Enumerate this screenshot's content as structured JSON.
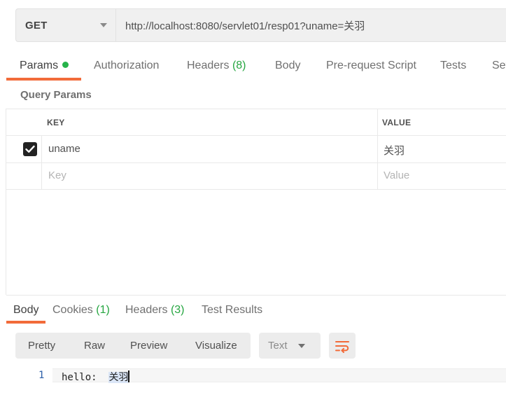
{
  "request": {
    "method": "GET",
    "url": "http://localhost:8080/servlet01/resp01?uname=关羽"
  },
  "request_tabs": [
    {
      "label": "Params",
      "count": ""
    },
    {
      "label": "Authorization",
      "count": ""
    },
    {
      "label": "Headers",
      "count": "(8)"
    },
    {
      "label": "Body",
      "count": ""
    },
    {
      "label": "Pre-request Script",
      "count": ""
    },
    {
      "label": "Tests",
      "count": ""
    },
    {
      "label": "Set",
      "count": ""
    }
  ],
  "query_params": {
    "title": "Query Params",
    "key_header": "KEY",
    "value_header": "VALUE",
    "rows": [
      {
        "key": "uname",
        "value": "关羽",
        "checked": true
      }
    ],
    "placeholder_key": "Key",
    "placeholder_value": "Value"
  },
  "response_tabs": [
    {
      "label": "Body",
      "count": ""
    },
    {
      "label": "Cookies",
      "count": "(1)"
    },
    {
      "label": "Headers",
      "count": "(3)"
    },
    {
      "label": "Test Results",
      "count": ""
    }
  ],
  "view_modes": [
    "Pretty",
    "Raw",
    "Preview",
    "Visualize"
  ],
  "format_select": "Text",
  "response_body": {
    "line_number": "1",
    "prefix": "hello:  ",
    "highlighted": "关羽"
  },
  "colors": {
    "accent": "#f26b3a",
    "count_green": "#26a641",
    "active_dot": "#26b34a"
  },
  "icons": {
    "method_dropdown": "chevron-down-icon",
    "format_dropdown": "chevron-down-icon",
    "checkbox": "checkmark-icon",
    "wrap": "wrap-lines-icon"
  }
}
